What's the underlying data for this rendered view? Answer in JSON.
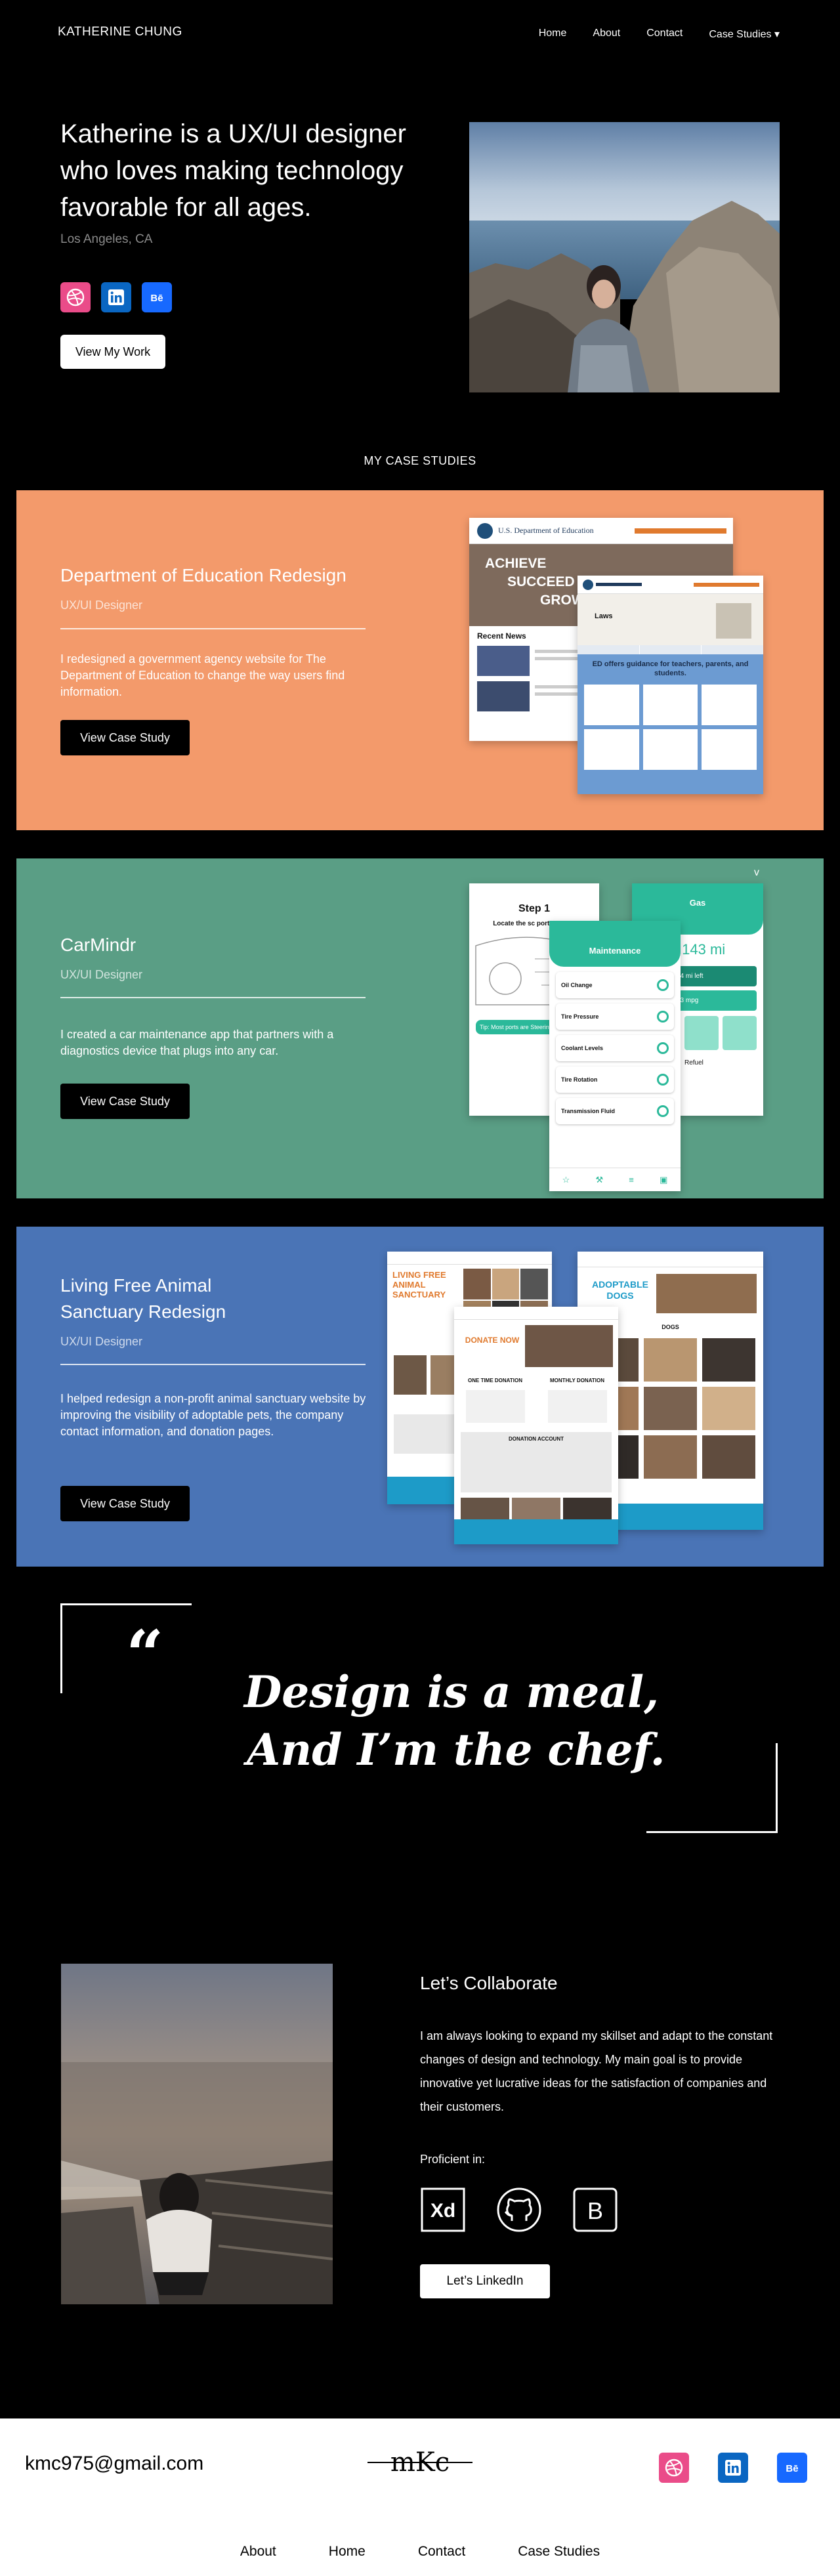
{
  "nav": {
    "brand": "KATHERINE CHUNG",
    "links": [
      "Home",
      "About",
      "Contact",
      "Case Studies ▾"
    ]
  },
  "hero": {
    "title": "Katherine is a UX/UI designer who loves making technology favorable for all ages.",
    "location": "Los Angeles, CA",
    "cta": "View My Work",
    "socials": [
      "dribbble-icon",
      "linkedin-icon",
      "behance-icon"
    ]
  },
  "case_studies": {
    "heading": "MY CASE STUDIES",
    "items": [
      {
        "title": "Department of Education Redesign",
        "role": "UX/UI Designer",
        "description": "I redesigned a government agency website for The Department of Education to change the way users find information.",
        "cta": "View Case Study",
        "color": "#f39a6b"
      },
      {
        "title": "CarMindr",
        "role": "UX/UI Designer",
        "description": "I created a car maintenance app that partners with a diagnostics device that plugs into any car.",
        "cta": "View Case Study",
        "color": "#5a9e85"
      },
      {
        "title": "Living Free Animal Sanctuary Redesign",
        "role": "UX/UI Designer",
        "description": "I helped redesign a non-profit animal sanctuary website by improving the visibility of adoptable pets, the company contact information, and donation pages.",
        "cta": "View Case Study",
        "color": "#4a74b6"
      }
    ]
  },
  "mockups": {
    "doe": {
      "header": "U.S. Department of Education",
      "hero_lines": [
        "ACHIEVE",
        "SUCCEED",
        "GROW"
      ],
      "news": "Recent News",
      "laws": "Laws",
      "guidance": "ED offers guidance for teachers, parents, and students."
    },
    "carmindr": {
      "step": "Step 1",
      "step_text": "Locate the sc port on your",
      "tip": "Tip: Most ports are Steering wheel on",
      "maintenance": "Maintenance",
      "items": [
        "Oil Change",
        "Tire Pressure",
        "Coolant Levels",
        "Tire Rotation",
        "Transmission Fluid"
      ],
      "gas": "Gas",
      "gas_value": "0.143 mi",
      "gas_left": "24 mi left",
      "mpg": "33 mpg",
      "refuel": "Refuel"
    },
    "living_free": {
      "hero": "LIVING FREE ANIMAL SANCTUARY",
      "donate": "DONATE NOW",
      "one_time": "ONE TIME DONATION",
      "monthly": "MONTHLY DONATION",
      "account": "DONATION ACCOUNT",
      "adoptable": "ADOPTABLE DOGS",
      "dogs": "DOGS"
    }
  },
  "quote": {
    "mark": "“",
    "line1": "Design is a meal,",
    "line2": "And I’m the chef."
  },
  "collab": {
    "title": "Let’s Collaborate",
    "text": "I am always looking to expand my skillset and adapt to the constant changes of design and technology. My main goal is to provide innovative yet lucrative ideas for the satisfaction of companies and their customers.",
    "proficient": "Proficient in:",
    "tools": [
      "adobe-xd-icon",
      "github-icon",
      "bootstrap-icon"
    ],
    "tool_labels": [
      "Xd",
      "",
      "B"
    ],
    "cta": "Let’s LinkedIn"
  },
  "footer": {
    "email": "kmc975@gmail.com",
    "logo": "mKc",
    "links": [
      "About",
      "Home",
      "Contact",
      "Case Studies"
    ]
  }
}
